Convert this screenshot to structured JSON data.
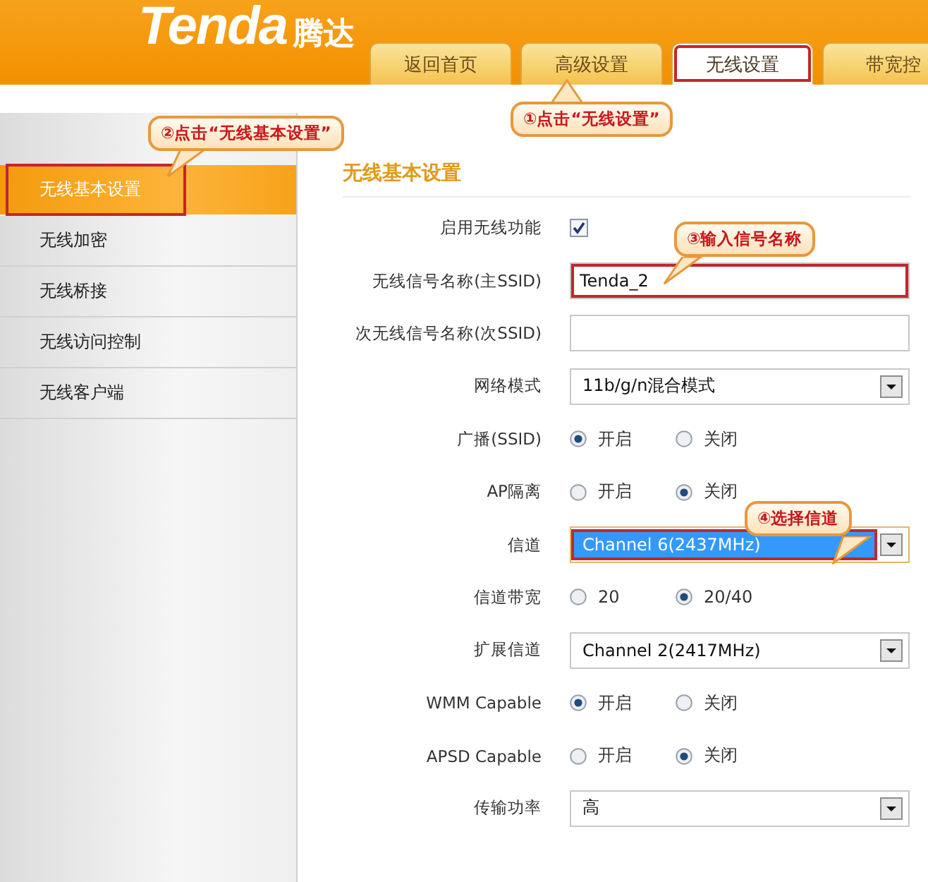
{
  "header": {
    "logo": {
      "brand": "Tenda",
      "name_cn": "腾达"
    },
    "tabs": [
      {
        "label": "返回首页",
        "selected": false,
        "highlighted": false
      },
      {
        "label": "高级设置",
        "selected": false,
        "highlighted": false
      },
      {
        "label": "无线设置",
        "selected": true,
        "highlighted": true
      },
      {
        "label": "带宽控",
        "selected": false,
        "highlighted": false
      }
    ]
  },
  "sidebar": {
    "items": [
      {
        "label": "无线基本设置",
        "selected": true,
        "highlighted": true
      },
      {
        "label": "无线加密",
        "selected": false,
        "highlighted": false
      },
      {
        "label": "无线桥接",
        "selected": false,
        "highlighted": false
      },
      {
        "label": "无线访问控制",
        "selected": false,
        "highlighted": false
      },
      {
        "label": "无线客户端",
        "selected": false,
        "highlighted": false
      }
    ]
  },
  "main": {
    "title": "无线基本设置",
    "rows": [
      {
        "label": "启用无线功能",
        "kind": "checkbox",
        "checked": true
      },
      {
        "label": "无线信号名称(主SSID)",
        "kind": "text",
        "value": "Tenda_2",
        "highlighted": true
      },
      {
        "label": "次无线信号名称(次SSID)",
        "kind": "text",
        "highlighted": false
      },
      {
        "label": "网络模式",
        "kind": "select",
        "value": "11b/g/n混合模式",
        "focused": false,
        "highlighted": false
      },
      {
        "label": "广播(SSID)",
        "kind": "radio",
        "options": [
          {
            "label": "开启",
            "selected": true
          },
          {
            "label": "关闭",
            "selected": false
          }
        ]
      },
      {
        "label": "AP隔离",
        "kind": "radio",
        "options": [
          {
            "label": "开启",
            "selected": false
          },
          {
            "label": "关闭",
            "selected": true
          }
        ]
      },
      {
        "label": "信道",
        "kind": "select",
        "value": "Channel 6(2437MHz)",
        "focused": true,
        "highlighted": true
      },
      {
        "label": "信道带宽",
        "kind": "radio",
        "options": [
          {
            "label": "20",
            "selected": false
          },
          {
            "label": "20/40",
            "selected": true
          }
        ]
      },
      {
        "label": "扩展信道",
        "kind": "select",
        "value": "Channel 2(2417MHz)",
        "focused": false,
        "highlighted": false
      },
      {
        "label": "WMM Capable",
        "kind": "radio",
        "options": [
          {
            "label": "开启",
            "selected": true
          },
          {
            "label": "关闭",
            "selected": false
          }
        ]
      },
      {
        "label": "APSD Capable",
        "kind": "radio",
        "options": [
          {
            "label": "开启",
            "selected": false
          },
          {
            "label": "关闭",
            "selected": true
          }
        ]
      },
      {
        "label": "传输功率",
        "kind": "select",
        "value": "高",
        "focused": false,
        "highlighted": false
      }
    ]
  },
  "callouts": [
    {
      "text": "①点击“无线设置”"
    },
    {
      "text": "②点击“无线基本设置”"
    },
    {
      "text": "③输入信号名称"
    },
    {
      "text": "④选择信道"
    }
  ]
}
